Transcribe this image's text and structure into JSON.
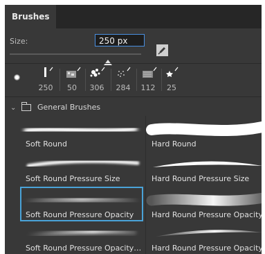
{
  "panel": {
    "tab_label": "Brushes"
  },
  "size": {
    "label": "Size:",
    "value": "250 px"
  },
  "presets": [
    {
      "num": "250",
      "icon": "soft-round-preset-icon"
    },
    {
      "num": "50",
      "icon": "chalk-preset-icon"
    },
    {
      "num": "306",
      "icon": "splatter-preset-icon"
    },
    {
      "num": "284",
      "icon": "spray-preset-icon"
    },
    {
      "num": "112",
      "icon": "texture-preset-icon"
    },
    {
      "num": "25",
      "icon": "star-preset-icon"
    }
  ],
  "group": {
    "name": "General Brushes"
  },
  "brushes": [
    {
      "name": "Soft Round"
    },
    {
      "name": "Hard Round"
    },
    {
      "name": "Soft Round Pressure Size"
    },
    {
      "name": "Hard Round Pressure Size"
    },
    {
      "name": "Soft Round Pressure Opacity"
    },
    {
      "name": "Hard Round Pressure Opacity"
    },
    {
      "name": "Soft Round Pressure Opacity ..."
    },
    {
      "name": "Hard Round Pressure Opacity..."
    }
  ],
  "colors": {
    "accent": "#4aa3d8",
    "panel": "#383838",
    "tabbar": "#262626"
  }
}
